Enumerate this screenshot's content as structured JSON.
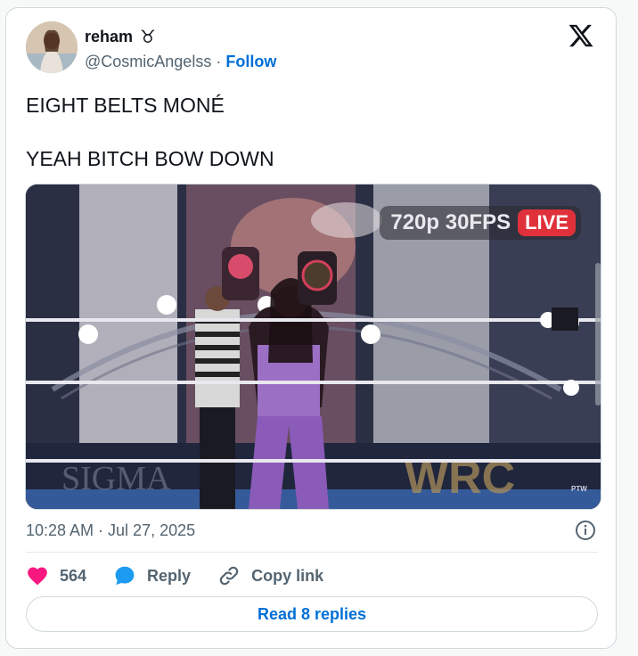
{
  "author": {
    "display_name": "reham",
    "zodiac_symbol": "♉",
    "handle": "@CosmicAngelss",
    "separator": "·",
    "follow_label": "Follow"
  },
  "tweet": {
    "lines": [
      "EIGHT BELTS MONÉ",
      "YEAH BITCH BOW DOWN"
    ]
  },
  "media": {
    "quality_label": "720p 30FPS",
    "live_label": "LIVE",
    "watermark": "WRC",
    "backdrop_text": "SIGMA",
    "corner_logo": "PTW"
  },
  "meta": {
    "timestamp": "10:28 AM · Jul 27, 2025"
  },
  "actions": {
    "likes": "564",
    "reply_label": "Reply",
    "copy_label": "Copy link"
  },
  "read_replies_label": "Read 8 replies",
  "colors": {
    "accent": "#006fd6",
    "heart": "#f91880",
    "reply_blue": "#1d9bf0",
    "live_red": "#e0313a"
  }
}
